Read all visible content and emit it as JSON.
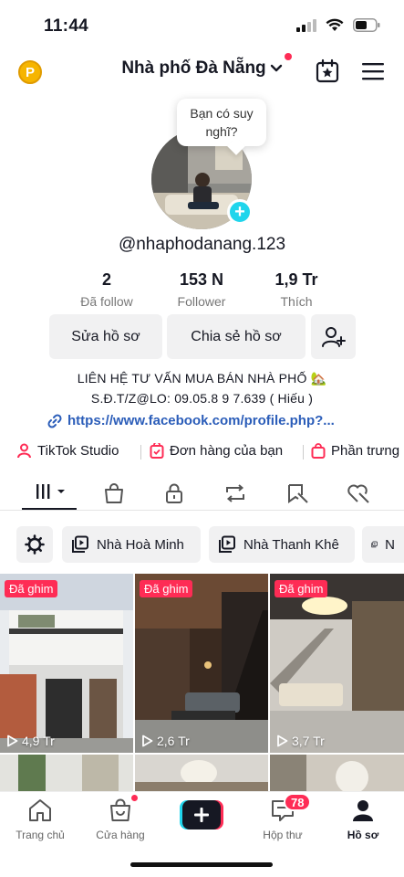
{
  "status_bar": {
    "time": "11:44"
  },
  "header": {
    "coin_label": "P",
    "title": "Nhà phố Đà Nẵng",
    "calendar_icon": "calendar-star-icon",
    "menu_icon": "hamburger-icon"
  },
  "profile": {
    "bubble_text": "Bạn có suy nghĩ?",
    "username": "@nhaphodanang.123",
    "stats": [
      {
        "value": "2",
        "label": "Đã follow"
      },
      {
        "value": "153 N",
        "label": "Follower"
      },
      {
        "value": "1,9 Tr",
        "label": "Thích"
      }
    ],
    "edit_label": "Sửa hồ sơ",
    "share_label": "Chia sẻ hồ sơ",
    "bio_line1": "LIÊN HỆ TƯ VẤN MUA BÁN NHÀ PHỐ 🏡",
    "bio_line2": "S.Đ.T/Z@LO: 09.05.8 9 7.639 ( Hiếu )",
    "link": "https://www.facebook.com/profile.php?..."
  },
  "quick_links": [
    {
      "label": "TikTok Studio",
      "icon": "studio-icon"
    },
    {
      "label": "Đơn hàng của bạn",
      "icon": "order-icon"
    },
    {
      "label": "Phần trưng",
      "icon": "showcase-icon"
    }
  ],
  "tabs": [
    "videos-grid",
    "shop-bag",
    "private-lock",
    "repost",
    "favorites",
    "liked"
  ],
  "collections": [
    {
      "label": "Nhà Hoà Minh"
    },
    {
      "label": "Nhà Thanh Khê"
    },
    {
      "label": "N"
    }
  ],
  "videos": [
    {
      "pinned": "Đã ghim",
      "views": "4,9 Tr"
    },
    {
      "pinned": "Đã ghim",
      "views": "2,6 Tr"
    },
    {
      "pinned": "Đã ghim",
      "views": "3,7 Tr"
    }
  ],
  "bottom_nav": {
    "home": "Trang chủ",
    "shop": "Cửa hàng",
    "inbox": "Hộp thư",
    "inbox_badge": "78",
    "profile": "Hồ sơ"
  },
  "colors": {
    "accent": "#fe2c55",
    "link": "#2b5db9",
    "cyan": "#20d5ec"
  }
}
